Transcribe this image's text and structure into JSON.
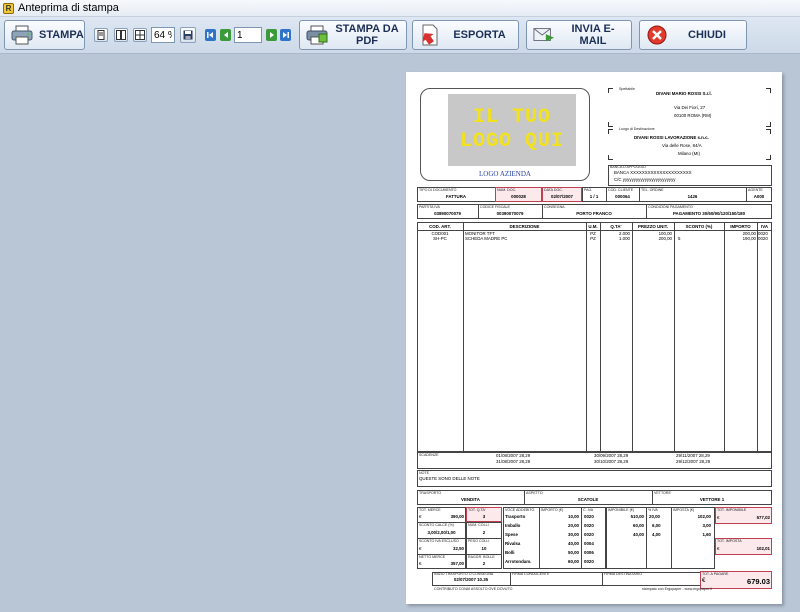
{
  "window": {
    "title": "Anteprima di stampa",
    "app_icon": "R"
  },
  "toolbar": {
    "print_label": "STAMPA",
    "zoom_value": "64 %",
    "page_value": "1",
    "pdf_label": "STAMPA DA PDF",
    "export_label": "ESPORTA",
    "email_label": "INVIA E-MAIL",
    "close_label": "CHIUDI"
  },
  "invoice": {
    "logo_line1": "IL TUO",
    "logo_line2": "LOGO QUI",
    "logo_caption": "LOGO AZIENDA",
    "recipient_caption": "Spettabile",
    "recipient_name": "DIVANI MARIO ROSSI S.r.l.",
    "recipient_street": "Via Dei Fiori, 27",
    "recipient_city": "00100 ROMA (RM)",
    "destination_caption": "Luogo di Destinazione",
    "destination_name": "DIVANI ROSSI LAVORAZIONE s.n.c.",
    "destination_street": "Via delle Rose, 84/A",
    "destination_city": "Milano (MI)",
    "bank_caption": "BANCA D'APPOGGIO",
    "bank_name": "BANCA XXXXXXXXXXXXXXXXXXXXX",
    "bank_account": "C/C yyyyyyyyyyyyyyyyyyyyyyyy",
    "doc_type_caption": "TIPO DI DOCUMENTO",
    "doc_type": "FATTURA",
    "doc_num_caption": "NUM. DOC.",
    "doc_num": "000028",
    "doc_date_caption": "DATA DOC.",
    "doc_date": "02/07/2007",
    "page_caption": "PAG.",
    "page": "1 / 1",
    "client_code_caption": "COD. CLIENTE",
    "client_code": "000064",
    "phone_caption": "TEL. ORDINE",
    "phone": "1426",
    "agent_caption": "AGENTE",
    "agent": "A000",
    "vat_caption": "PARTITA IVA",
    "vat": "03890070079",
    "fiscal_caption": "CODICE FISCALE",
    "fiscal": "00390070079",
    "delivery_caption": "CONSEGNA",
    "delivery": "PORTO FRANCO",
    "payment_caption": "CONDIZIONI PAGAMENTO",
    "payment": "PAGAMENTO 30/60/90/120/150/180",
    "table_headers": [
      "COD. ART.",
      "DESCRIZIONE",
      "U.M.",
      "Q.TA'",
      "PREZZO UNIT.",
      "SCONTO (%)",
      "IMPORTO",
      "IVA"
    ],
    "rows": [
      {
        "code": "COD001",
        "desc": "MONITOR TFT",
        "um": "PZ",
        "qty": "2.000",
        "price": "100,00",
        "discount": "",
        "amount": "200,00",
        "vat": "0020"
      },
      {
        "code": "SH-PC",
        "desc": "SCHEDA MADRE PC",
        "um": "PZ",
        "qty": "1.000",
        "price": "200,00",
        "discount": "5",
        "amount": "190,00",
        "vat": "0020"
      }
    ],
    "due_caption": "SCADENZE",
    "due_dates": [
      "01/08/2007  28,29",
      "30/09/2007  28,29",
      "29/11/2007  28,29",
      "31/08/2007  28,29",
      "30/10/2007  28,29",
      "29/12/2007  28,29"
    ],
    "notes_caption": "NOTE",
    "notes": "QUESTE SONO DELLE NOTE",
    "transport_caption": "TRASPORTO",
    "transport": "VENDITA",
    "aspect_caption": "ASPETTO",
    "aspect": "SCATOLE",
    "carrier_caption": "VETTORE",
    "carrier": "VETTORE 1",
    "goods_caption": "TOT. MERCE",
    "goods_currency": "€",
    "goods": "390,00",
    "qty_total_caption": "TOT. Q.TA'",
    "qty_total": "3",
    "discount_header_caption": "SCONTO CALCE (%)",
    "discount_header": "3,00/2,00/1,00",
    "colli_caption": "NUM. COLLI",
    "colli": "2",
    "discount_excluded_caption": "SCONTO IVA ESCLUSO",
    "discount_excluded_currency": "€",
    "discount_excluded": "32,50",
    "weight_caption": "PESO COLLI",
    "weight": "10",
    "net_caption": "NETTO MERCE",
    "net_currency": "€",
    "net": "357,00",
    "aggr_caption": "RAGGR. BOLLE",
    "aggr": "2",
    "charges_captions": [
      "VOCE ADDEBITO",
      "IMPORTO (€)",
      "C. IVA"
    ],
    "charges": [
      {
        "name": "Trasporto",
        "amount": "10,00",
        "code": "0020"
      },
      {
        "name": "Imballo",
        "amount": "20,00",
        "code": "0020"
      },
      {
        "name": "Spese",
        "amount": "30,00",
        "code": "0020"
      },
      {
        "name": "Rivalsa",
        "amount": "40,00",
        "code": "0004"
      },
      {
        "name": "Bolli",
        "amount": "50,00",
        "code": "0006"
      },
      {
        "name": "Arrotondam.",
        "amount": "60,00",
        "code": "0020"
      }
    ],
    "vat_summary_captions": [
      "IMPONIBILE (€)",
      "% IVA",
      "IMPOSTA (€)"
    ],
    "vat_summary": [
      {
        "base": "510,00",
        "rate": "20,00",
        "tax": "102,00"
      },
      {
        "base": "60,00",
        "rate": "6,00",
        "tax": "3,00"
      },
      {
        "base": "40,00",
        "rate": "4,00",
        "tax": "1,60"
      }
    ],
    "taxable_caption": "TOT. IMPONIBILE",
    "taxable_currency": "€",
    "taxable": "577,02",
    "tax_caption": "TOT. IMPOSTA",
    "tax_currency": "€",
    "tax": "102,01",
    "start_caption": "INIZIO TRASPORTO O CONSEGNA",
    "start": "02/07/2007 10.35",
    "driver_caption": "FIRMA CONDUCENTE",
    "recipient_sig_caption": "FIRMA DESTINATARIO",
    "total_caption": "TOT. A PAGARE",
    "total_currency": "€",
    "total": "679.03",
    "footer_left": "CONTRIBUTO CONAI ASSOLTO OVE DOVUTO",
    "footer_right": "stampato con Ergopaper - www.ergopaper.it"
  }
}
